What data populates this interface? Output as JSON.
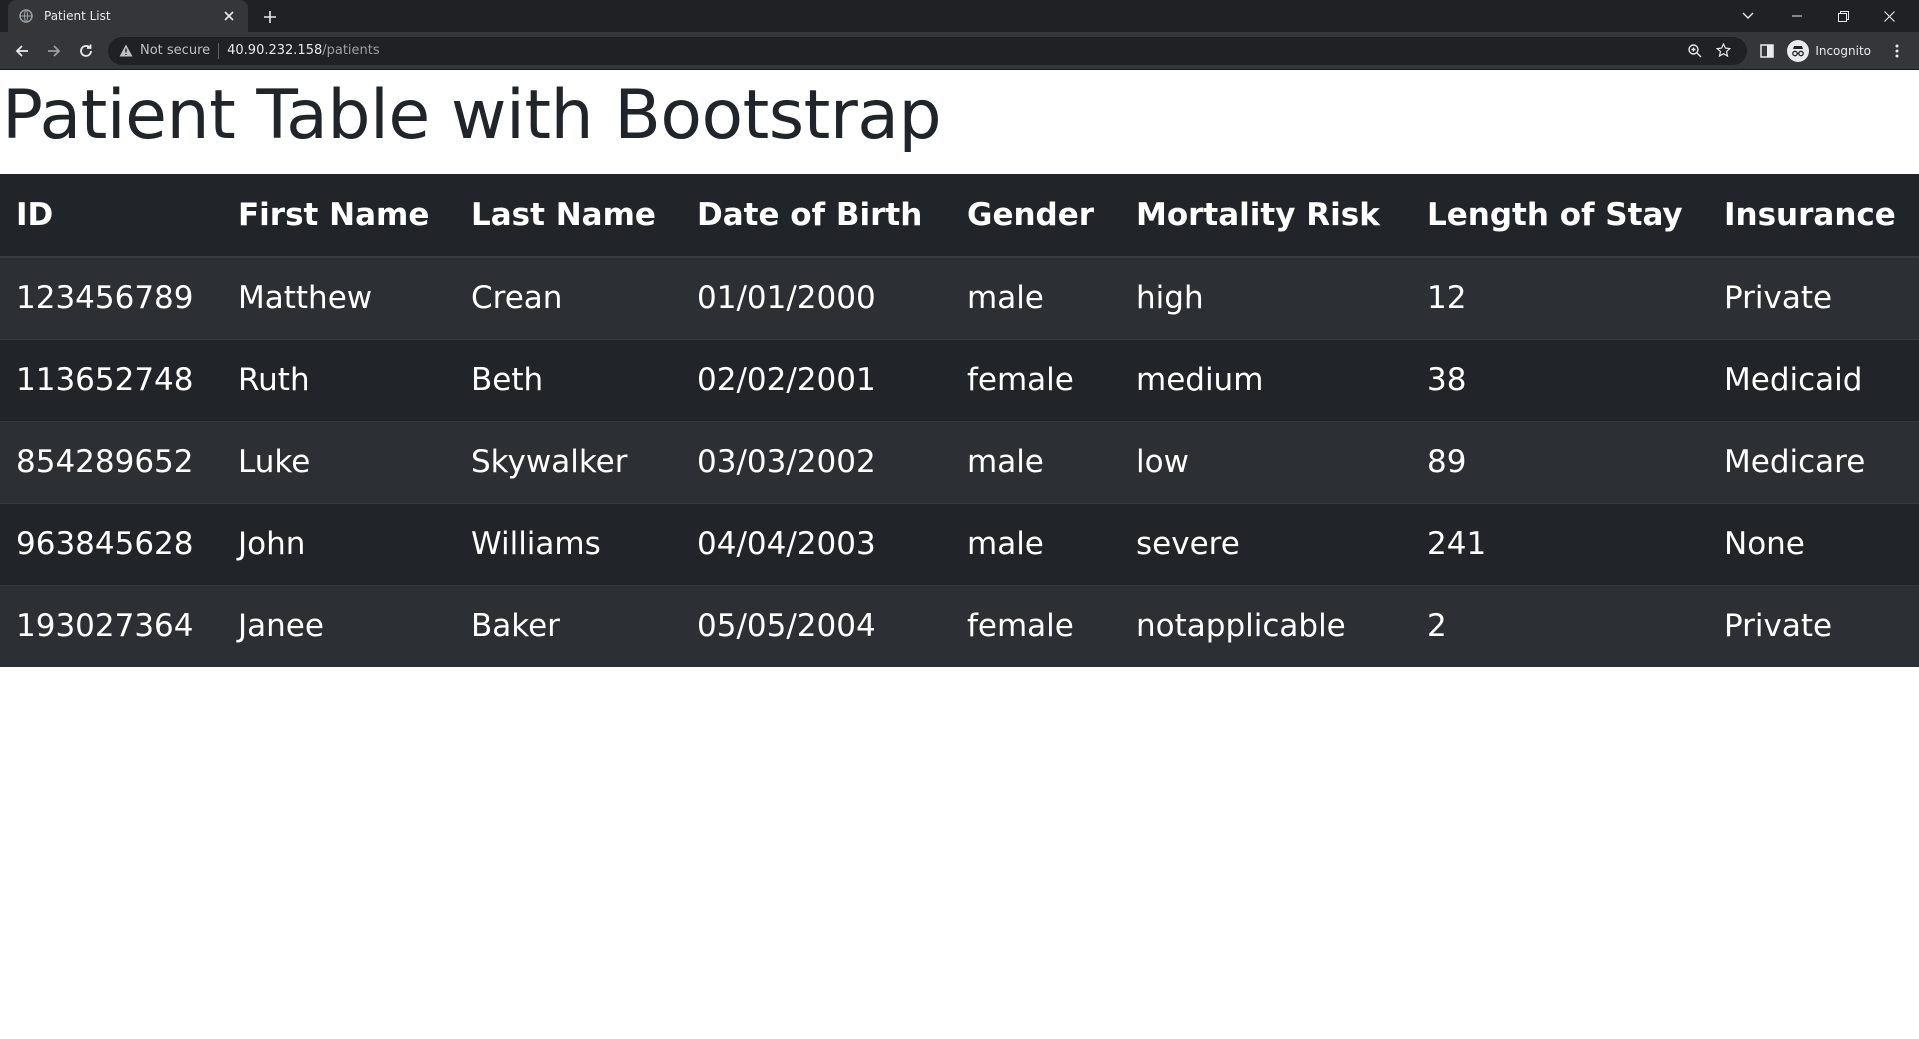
{
  "browser": {
    "tab_title": "Patient List",
    "url_security": "Not secure",
    "url_host": "40.90.232.158",
    "url_path": "/patients",
    "profile_label": "Incognito"
  },
  "page": {
    "title": "Patient Table with Bootstrap"
  },
  "table": {
    "headers": [
      "ID",
      "First Name",
      "Last Name",
      "Date of Birth",
      "Gender",
      "Mortality Risk",
      "Length of Stay",
      "Insurance"
    ],
    "rows": [
      [
        "123456789",
        "Matthew",
        "Crean",
        "01/01/2000",
        "male",
        "high",
        "12",
        "Private"
      ],
      [
        "113652748",
        "Ruth",
        "Beth",
        "02/02/2001",
        "female",
        "medium",
        "38",
        "Medicaid"
      ],
      [
        "854289652",
        "Luke",
        "Skywalker",
        "03/03/2002",
        "male",
        "low",
        "89",
        "Medicare"
      ],
      [
        "963845628",
        "John",
        "Williams",
        "04/04/2003",
        "male",
        "severe",
        "241",
        "None"
      ],
      [
        "193027364",
        "Janee",
        "Baker",
        "05/05/2004",
        "female",
        "notapplicable",
        "2",
        "Private"
      ]
    ]
  },
  "colors": {
    "table_dark": "#212529",
    "table_stripe": "#2c3034",
    "title_text": "#212529"
  }
}
